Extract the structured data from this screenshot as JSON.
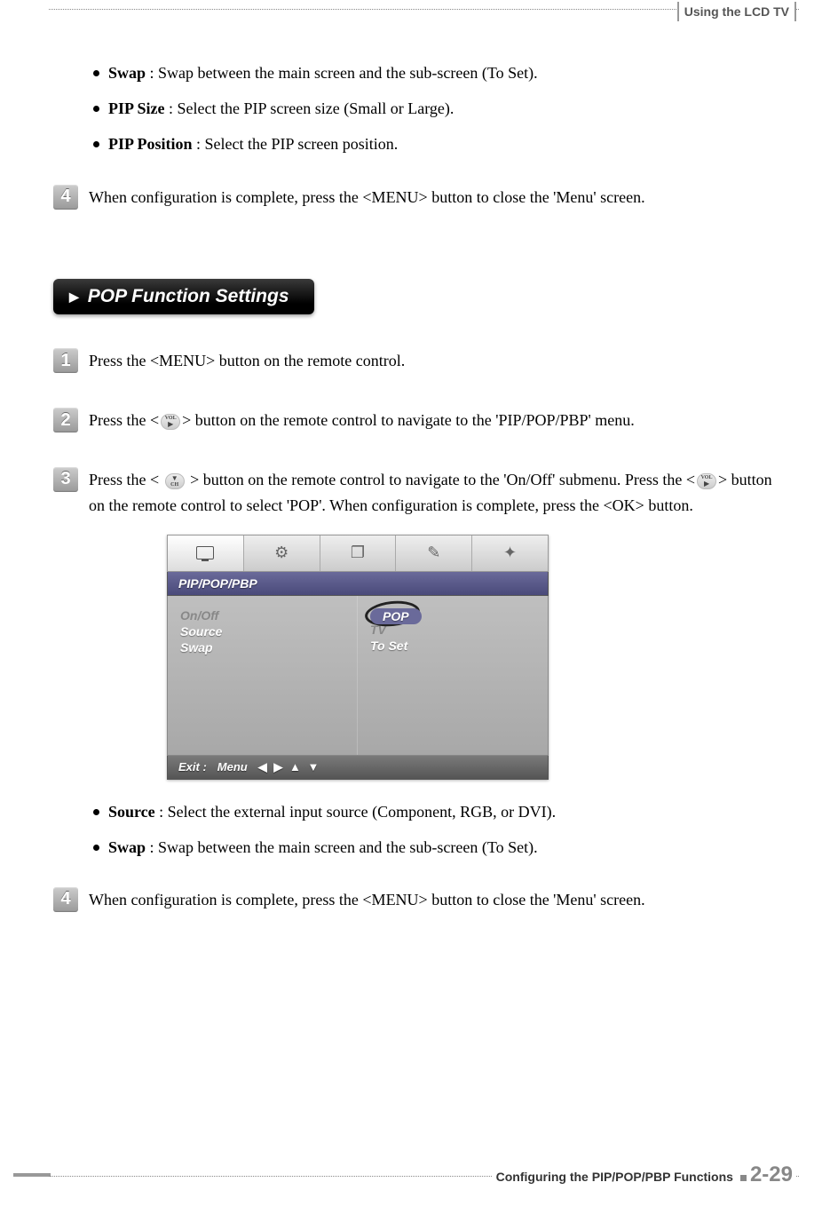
{
  "header": {
    "tag": "Using the LCD TV"
  },
  "top_bullets": [
    {
      "term": "Swap",
      "desc": " : Swap between the main screen and the sub-screen (To Set)."
    },
    {
      "term": "PIP Size",
      "desc": " : Select the PIP screen size (Small or Large)."
    },
    {
      "term": "PIP Position",
      "desc": " : Select the PIP screen position."
    }
  ],
  "top_step4": {
    "num": "4",
    "text": "When configuration is complete, press the <MENU> button to close the 'Menu' screen."
  },
  "section": {
    "arrow": "▶",
    "title": "POP Function Settings"
  },
  "steps": {
    "s1": {
      "num": "1",
      "text": "Press the <MENU> button on the remote control."
    },
    "s2": {
      "num": "2",
      "pre": "Press the <",
      "icon_label": "VOL",
      "icon_sym": "▶",
      "post": "> button on the remote control to navigate to the 'PIP/POP/PBP' menu."
    },
    "s3": {
      "num": "3",
      "line1_pre": "Press the < ",
      "line1_icon_label": "CH",
      "line1_icon_sym": "▼",
      "line1_post": " > button on the remote control to navigate to the 'On/Off' submenu.",
      "line2_pre": "Press the <",
      "line2_icon_label": "VOL",
      "line2_icon_sym": "▶",
      "line2_post": "> button on the remote control to select 'POP'. When configuration is complete, press the <OK> button."
    },
    "s4": {
      "num": "4",
      "text": "When configuration is complete, press the <MENU> button to close the 'Menu' screen."
    }
  },
  "osd": {
    "title": "PIP/POP/PBP",
    "rows_left": [
      "On/Off",
      "Source",
      "Swap"
    ],
    "rows_right": [
      "POP",
      "TV",
      "To Set"
    ],
    "foot_label": "Exit :",
    "foot_menu": "Menu",
    "foot_arrows": "◀ ▶ ▲ ▼"
  },
  "bottom_bullets": [
    {
      "term": "Source",
      "desc": " : Select the external input source (Component, RGB, or DVI)."
    },
    {
      "term": "Swap",
      "desc": " : Swap between the main screen and the sub-screen (To Set)."
    }
  ],
  "footer": {
    "text": "Configuring the PIP/POP/PBP Functions",
    "page": "2-29"
  }
}
